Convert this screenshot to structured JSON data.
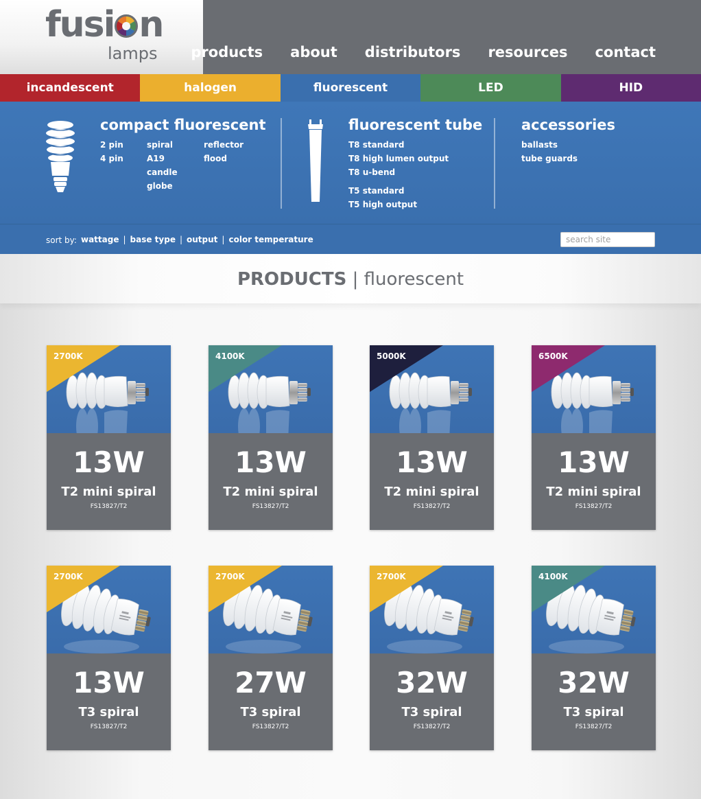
{
  "logo": {
    "word": "fusion",
    "word_a": "fusi",
    "word_b": "n",
    "sub": "lamps"
  },
  "nav": [
    "products",
    "about",
    "distributors",
    "resources",
    "contact"
  ],
  "categories": [
    {
      "label": "incandescent",
      "color": "#b2252c"
    },
    {
      "label": "halogen",
      "color": "#ebaf2e"
    },
    {
      "label": "fluorescent",
      "color": "#3a6fae"
    },
    {
      "label": "LED",
      "color": "#4d8a58"
    },
    {
      "label": "HID",
      "color": "#5e2b70"
    }
  ],
  "panel": {
    "compact": {
      "title": "compact fluorescent",
      "col1": [
        "2 pin",
        "4 pin"
      ],
      "col2": [
        "spiral",
        "A19",
        "candle",
        "globe"
      ],
      "col3": [
        "reflector",
        "flood"
      ]
    },
    "tube": {
      "title": "fluorescent tube",
      "items": [
        "T8 standard",
        "T8 high lumen output",
        "T8 u-bend",
        "T5 standard",
        "T5 high output"
      ]
    },
    "accessories": {
      "title": "accessories",
      "items": [
        "ballasts",
        "tube guards"
      ]
    }
  },
  "sort": {
    "label": "sort by:",
    "options": [
      "wattage",
      "base type",
      "output",
      "color temperature"
    ],
    "sep": "|"
  },
  "search": {
    "placeholder": "search site"
  },
  "title": {
    "strong": "PRODUCTS",
    "sep": "|",
    "rest": "fluorescent"
  },
  "products": [
    {
      "kelvin": "2700K",
      "color": "#ebb630",
      "watt": "13W",
      "name": "T2 mini spiral",
      "sku": "FS13827/T2"
    },
    {
      "kelvin": "4100K",
      "color": "#4a8a86",
      "watt": "13W",
      "name": "T2 mini spiral",
      "sku": "FS13827/T2"
    },
    {
      "kelvin": "5000K",
      "color": "#1e1f3d",
      "watt": "13W",
      "name": "T2 mini spiral",
      "sku": "FS13827/T2"
    },
    {
      "kelvin": "6500K",
      "color": "#8e2a6e",
      "watt": "13W",
      "name": "T2 mini spiral",
      "sku": "FS13827/T2"
    },
    {
      "kelvin": "2700K",
      "color": "#ebb630",
      "watt": "13W",
      "name": "T3 spiral",
      "sku": "FS13827/T2"
    },
    {
      "kelvin": "2700K",
      "color": "#ebb630",
      "watt": "27W",
      "name": "T3 spiral",
      "sku": "FS13827/T2"
    },
    {
      "kelvin": "2700K",
      "color": "#ebb630",
      "watt": "32W",
      "name": "T3 spiral",
      "sku": "FS13827/T2"
    },
    {
      "kelvin": "4100K",
      "color": "#4a8a86",
      "watt": "32W",
      "name": "T3 spiral",
      "sku": "FS13827/T2"
    }
  ]
}
